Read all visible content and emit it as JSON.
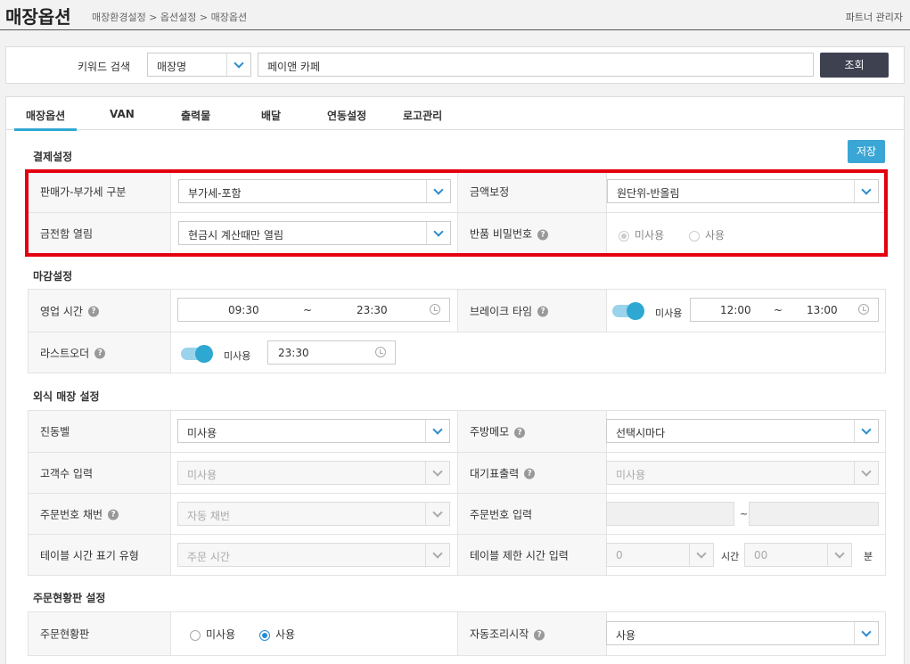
{
  "header": {
    "title": "매장옵션",
    "breadcrumb": "매장환경설정 > 옵션설정 > 매장옵션",
    "partner_link": "파트너 관리자"
  },
  "search": {
    "label": "키워드 검색",
    "type_value": "매장명",
    "keyword_value": "페이앤 카페",
    "button": "조회"
  },
  "tabs": [
    "매장옵션",
    "VAN",
    "출력물",
    "배달",
    "연동설정",
    "로고관리"
  ],
  "save_button": "저장",
  "payment": {
    "title": "결제설정",
    "vat_label": "판매가-부가세 구분",
    "vat_value": "부가세-포함",
    "amount_label": "금액보정",
    "amount_value": "원단위-반올림",
    "drawer_label": "금전함 열림",
    "drawer_value": "현금시 계산때만 열림",
    "refund_pw_label": "반품 비밀번호",
    "radio_unused": "미사용",
    "radio_used": "사용"
  },
  "closing": {
    "title": "마감설정",
    "hours_label": "영업 시간",
    "hours_start": "09:30",
    "hours_end": "23:30",
    "tilde": "~",
    "break_label": "브레이크 타임",
    "break_toggle": "미사용",
    "break_start": "12:00",
    "break_end": "13:00",
    "last_order_label": "라스트오더",
    "last_order_toggle": "미사용",
    "last_order_time": "23:30"
  },
  "dinein": {
    "title": "외식 매장 설정",
    "bell_label": "진동벨",
    "bell_value": "미사용",
    "kitchen_memo_label": "주방메모",
    "kitchen_memo_value": "선택시마다",
    "guest_label": "고객수 입력",
    "guest_value": "미사용",
    "waiting_label": "대기표출력",
    "waiting_value": "미사용",
    "order_no_label": "주문번호 채번",
    "order_no_value": "자동 채번",
    "order_input_label": "주문번호 입력",
    "tilde": "~",
    "table_time_label": "테이블 시간 표기 유형",
    "table_time_value": "주문 시간",
    "table_limit_label": "테이블 제한 시간 입력",
    "limit_hour": "0",
    "hour_unit": "시간",
    "limit_min": "00",
    "min_unit": "분"
  },
  "board": {
    "title": "주문현황판 설정",
    "board_label": "주문현황판",
    "radio_unused": "미사용",
    "radio_used": "사용",
    "autocook_label": "자동조리시작",
    "autocook_value": "사용"
  },
  "help_mark": "?"
}
